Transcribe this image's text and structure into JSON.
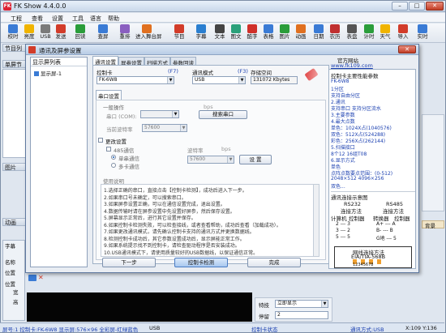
{
  "app": {
    "title": "FK Show 4.4.0.0",
    "logo_text": "FK"
  },
  "window_controls": {
    "minimize": "–",
    "maximize": "□",
    "close": "✕"
  },
  "menu": [
    "工程",
    "查看",
    "设置",
    "工具",
    "语言",
    "帮助"
  ],
  "toolbar": [
    {
      "label": "校时",
      "icon": "clock-icon",
      "color": "#3a7bd5"
    },
    {
      "label": "亮度",
      "icon": "brightness-icon",
      "color": "#f0b400"
    },
    {
      "label": "USB",
      "icon": "usb-icon",
      "color": "#7a7a7a"
    },
    {
      "label": "发送",
      "icon": "send-icon",
      "color": "#d23c2a"
    },
    {
      "label": "回读",
      "icon": "readback-icon",
      "color": "#2a9d3a"
    },
    {
      "label": "查屏",
      "icon": "find-screen-icon",
      "color": "#3a7bd5"
    },
    {
      "label": "重排",
      "icon": "rearrange-icon",
      "color": "#8a5fc0"
    },
    {
      "label": "进入舞台屏",
      "icon": "stage-icon",
      "color": "#e07020"
    },
    {
      "label": "节目",
      "icon": "program-icon",
      "color": "#d23c2a"
    },
    {
      "label": "字幕",
      "icon": "subtitle-icon",
      "color": "#2a7fd0"
    },
    {
      "label": "文本",
      "icon": "text-icon",
      "color": "#444444"
    },
    {
      "label": "图文",
      "icon": "graphic-text-icon",
      "color": "#2aa07a"
    },
    {
      "label": "酷字",
      "icon": "cool-text-icon",
      "color": "#d0302a"
    },
    {
      "label": "表格",
      "icon": "table-icon",
      "color": "#3a7bd5"
    },
    {
      "label": "图片",
      "icon": "picture-icon",
      "color": "#2a9d3a"
    },
    {
      "label": "动画",
      "icon": "animation-icon",
      "color": "#e07020"
    },
    {
      "label": "日期",
      "icon": "date-icon",
      "color": "#3a7bd5"
    },
    {
      "label": "农历",
      "icon": "lunar-icon",
      "color": "#c03030"
    },
    {
      "label": "表盘",
      "icon": "clock-dial-icon",
      "color": "#555555"
    },
    {
      "label": "计时",
      "icon": "timer-icon",
      "color": "#2a9d3a"
    },
    {
      "label": "天气",
      "icon": "weather-icon",
      "color": "#f0b400"
    },
    {
      "label": "导入",
      "icon": "import-icon",
      "color": "#d23c2a"
    },
    {
      "label": "实时",
      "icon": "realtime-icon",
      "color": "#3a7bd5"
    }
  ],
  "background": {
    "program_list_header": "节目列",
    "single_screen": "单屏节",
    "side_labels": [
      "图片",
      "动画",
      "字幕",
      "名称",
      "位置",
      "位置",
      "宽",
      "高"
    ],
    "right_label": "背景",
    "bottom_fields": [
      {
        "label": "特技",
        "value": "立即显示"
      },
      {
        "label": "停留",
        "value": "2"
      }
    ]
  },
  "status": {
    "screen": "屏号:1 控制卡:FK-6W8 显示屏:576×96 全彩屏-红绿蓝色",
    "usb": "USB",
    "card_state": "控制卡状态",
    "comm": "通讯方式:USB",
    "coords": "X:109 Y:136"
  },
  "dialog": {
    "title": "通讯及屏参设置",
    "close": "✕",
    "screen_list_header": "显示屏列表",
    "screen_item": "显示屏-1",
    "tabs": [
      "通讯设置",
      "屏参设置",
      "扫描方式",
      "参数回读"
    ],
    "control_card": {
      "label": "控制卡",
      "hint": "(F7)",
      "value": "FK-6W8"
    },
    "comm_mode": {
      "label": "通讯模式",
      "hint": "(F3)",
      "value": "USB"
    },
    "storage": {
      "label": "存储空间",
      "value": "131072 Kbytes"
    },
    "serial_tab": "串口设置",
    "general_op": "一般操作",
    "serial_port_label": "串口 (COM):",
    "bps": "bps",
    "search_port_btn": "搜索串口",
    "baud_label": "当前波特率",
    "baud_value": "57600",
    "change_settings": "更改设置",
    "rs485": "485通信",
    "single_comm": "单串通信",
    "multi_comm": "多卡通信",
    "baud_rate_label": "波特率",
    "baud_rate_value": "57600",
    "bps2": "bps",
    "set_btn": "设 置",
    "usage_title": "使用说明",
    "usage_lines": [
      "1.选择正确的串口，直接点击【控制卡检测】，成功后进入下一步。",
      "2.如果串口号未确定，可以搜索串口。",
      "3.如果屏参设置正确，可以在通信设置完成，退出设置。",
      "4.数据传输时请在屏参设置中先设置好屏参，然后保存设置。",
      "5.屏幕显示正常后，进行其它设置并保存。",
      "6.如果控制卡检测失败，可以检查接线，或者查看帮助，成功后查看（加载成功）。",
      "7.如果更改通讯模式，请先确认控制卡支持的通讯方式并更换数据线。",
      "8.检测控制卡成功后，其它参数设置成功后，显示屏能正常工作。",
      "9.如果系统提示找不到控制卡，请检查驱动程序是否安装成功。",
      "10.USB通讯模式下，请使用质量较好的USB数据线，以保证通信正常。"
    ],
    "next_btn": "下一步",
    "detect_btn": "控制卡检测",
    "done_btn": "完成",
    "help": {
      "website_label": "官方网站",
      "website_url": "www.fk109.com",
      "feature_title": "控制卡主要性能参数",
      "specs": [
        "FK-6W8",
        "1分区",
        "  支持自由分区",
        "2.通讯",
        "  支持串口 支持分区流水",
        "3.主要参数",
        "4.最大点数",
        "  单色：1024X占(1040576)",
        "  双色：512X占(524288)",
        "  彩色：256X占(262144)",
        "5.扫描接口",
        "  8个12 16组T08",
        "6.显示方式",
        "  单色",
        "  点阵点数要点范围：(0-512)",
        "  2048×512 4096×256",
        "  双色..."
      ],
      "diagram_title": "通讯连接示意图",
      "rs232": "RS232",
      "rs485": "RS485",
      "connect_method": "连接方法",
      "computer": "计算机",
      "controller": "控制器",
      "converter": "转换器",
      "wiring": [
        "2 --- 3",
        "3 --- 2",
        "5 --- 5"
      ],
      "wiring2": [
        "A+ --- A",
        "B- --- B",
        "G地 --- 5"
      ],
      "rj45_title": "网线连接方法",
      "rj45_sub": "EIA/TIA-568B",
      "rj45_pins": "12345678"
    }
  }
}
